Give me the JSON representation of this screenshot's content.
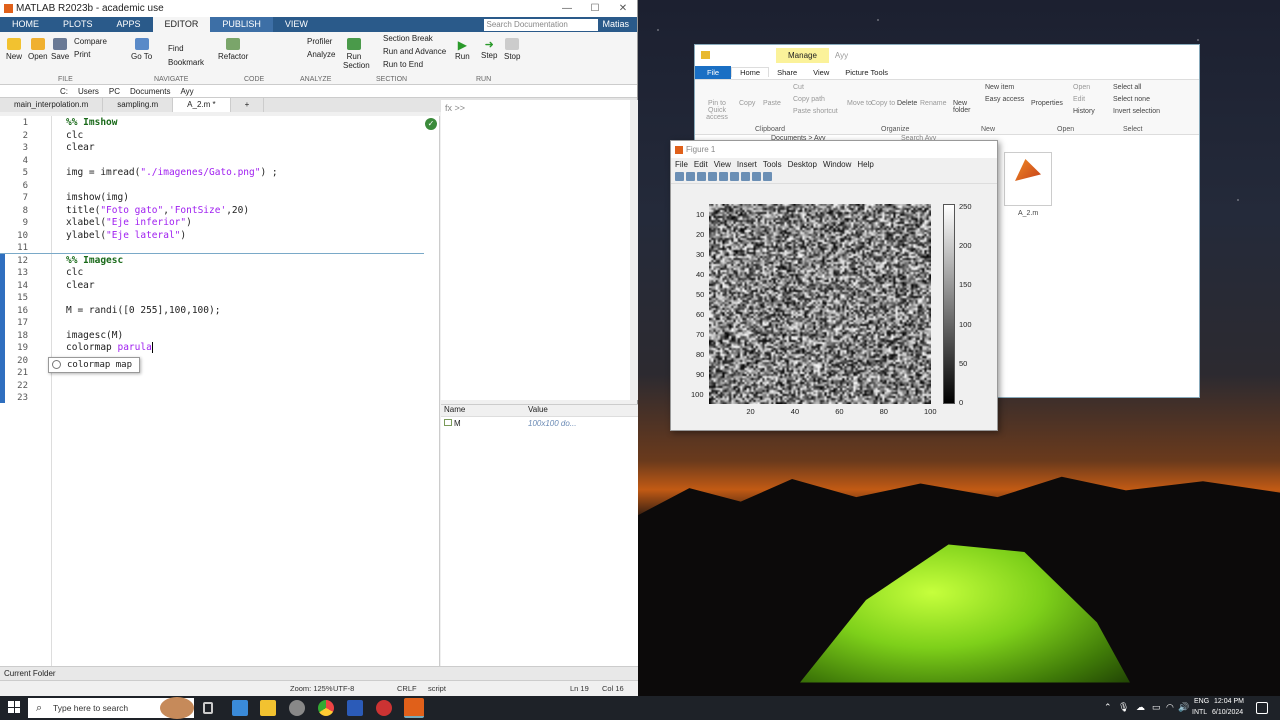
{
  "matlab": {
    "title": "MATLAB R2023b - academic use",
    "ribbon_tabs": [
      "HOME",
      "PLOTS",
      "APPS",
      "EDITOR",
      "PUBLISH",
      "VIEW"
    ],
    "search_placeholder": "Search Documentation",
    "user": "Matias",
    "buttons": {
      "new": "New",
      "open": "Open",
      "save": "Save",
      "compare": "Compare",
      "print": "Print",
      "goto": "Go To",
      "find": "Find",
      "bookmark": "Bookmark",
      "refactor": "Refactor",
      "profiler": "Profiler",
      "analyze": "Analyze",
      "run_section": "Run Section",
      "section_break": "Section Break",
      "run_advance": "Run and Advance",
      "run_end": "Run to End",
      "run": "Run",
      "step": "Step",
      "stop": "Stop"
    },
    "groups": [
      "FILE",
      "NAVIGATE",
      "CODE",
      "ANALYZE",
      "SECTION",
      "RUN"
    ],
    "path": [
      "C:",
      "Users",
      "PC",
      "Documents",
      "Ayy"
    ],
    "editor_tabs": [
      "main_interpolation.m",
      "sampling.m",
      "A_2.m *"
    ],
    "add_tab": "+",
    "line_numbers": [
      "1",
      "2",
      "3",
      "4",
      "5",
      "6",
      "7",
      "8",
      "9",
      "10",
      "11",
      "12",
      "13",
      "14",
      "15",
      "16",
      "17",
      "18",
      "19",
      "20",
      "21",
      "22",
      "23"
    ],
    "code": {
      "l1": "%% Imshow",
      "l2": "clc",
      "l3": "clear",
      "l5a": "img = imread(",
      "l5s": "\"./imagenes/Gato.png\"",
      "l5b": ") ;",
      "l7": "imshow(img)",
      "l8a": "title(",
      "l8s1": "\"Foto gato\"",
      "l8c": ",",
      "l8s2": "'FontSize'",
      "l8b": ",20)",
      "l9a": "xlabel(",
      "l9s": "\"Eje inferior\"",
      "l9b": ")",
      "l10a": "ylabel(",
      "l10s": "\"Eje lateral\"",
      "l10b": ")",
      "l12": "%% Imagesc",
      "l13": "clc",
      "l14": "clear",
      "l16": "M = randi([0 255],100,100);",
      "l18": "imagesc(M)",
      "l19a": "colormap ",
      "l19s": "parula"
    },
    "autocomplete": "colormap map",
    "cmd_prompt": "fx >>",
    "workspace": {
      "headers": [
        "Name",
        "Value"
      ],
      "rows": [
        {
          "name": "M",
          "value": "100x100 do..."
        }
      ]
    },
    "current_folder": "Current Folder",
    "status": {
      "zoom": "Zoom: 125%",
      "encoding": "UTF-8",
      "eol": "CRLF",
      "mode": "script",
      "ln": "Ln  19",
      "col": "Col  16"
    }
  },
  "explorer": {
    "manage": "Manage",
    "title": "Ayy",
    "menus": [
      "File",
      "Home",
      "Share",
      "View",
      "Picture Tools"
    ],
    "ribbon": {
      "pin": "Pin to Quick access",
      "copy": "Copy",
      "paste": "Paste",
      "cut": "Cut",
      "copy_path": "Copy path",
      "paste_shortcut": "Paste shortcut",
      "move": "Move to",
      "copyto": "Copy to",
      "delete": "Delete",
      "rename": "Rename",
      "new_folder": "New folder",
      "new_item": "New item",
      "easy_access": "Easy access",
      "properties": "Properties",
      "open": "Open",
      "edit": "Edit",
      "history": "History",
      "select_all": "Select all",
      "select_none": "Select none",
      "invert": "Invert selection"
    },
    "groups": [
      "Clipboard",
      "Organize",
      "New",
      "Open",
      "Select"
    ],
    "breadcrumb": "Documents  >  Ayy",
    "search": "Search Ayy",
    "file": "A_2.m"
  },
  "figure": {
    "title": "Figure 1",
    "menus": [
      "File",
      "Edit",
      "View",
      "Insert",
      "Tools",
      "Desktop",
      "Window",
      "Help"
    ],
    "yticks": [
      "10",
      "20",
      "30",
      "40",
      "50",
      "60",
      "70",
      "80",
      "90",
      "100"
    ],
    "xticks": [
      "20",
      "40",
      "60",
      "80",
      "100"
    ],
    "cticks": [
      "250",
      "200",
      "150",
      "100",
      "50",
      "0"
    ]
  },
  "taskbar": {
    "search": "Type here to search",
    "lang": "ENG",
    "region": "INTL",
    "time": "12:04 PM",
    "date": "6/10/2024"
  }
}
